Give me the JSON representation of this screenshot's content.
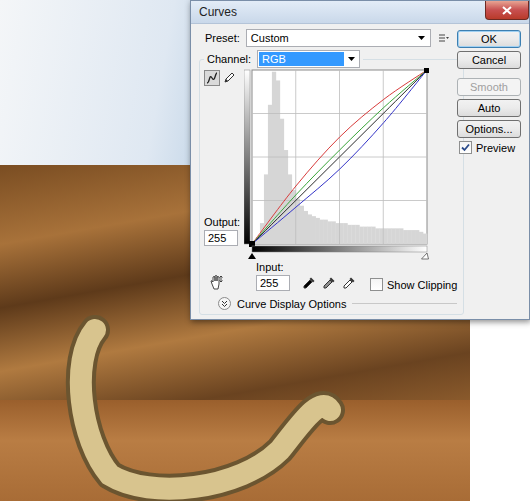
{
  "window": {
    "title": "Curves"
  },
  "preset": {
    "label": "Preset:",
    "value": "Custom"
  },
  "channel": {
    "label": "Channel:",
    "value": "RGB",
    "selected": true
  },
  "tools": [
    {
      "kind": "curve",
      "selected": true
    },
    {
      "kind": "pencil",
      "selected": false
    }
  ],
  "output": {
    "label": "Output:",
    "value": "255"
  },
  "input": {
    "label": "Input:",
    "value": "255"
  },
  "eyedroppers": [
    {
      "kind": "black"
    },
    {
      "kind": "gray"
    },
    {
      "kind": "white"
    }
  ],
  "show_clipping": {
    "label": "Show Clipping",
    "checked": false
  },
  "display_options": {
    "label": "Curve Display Options",
    "expanded": false
  },
  "buttons": [
    {
      "label": "OK",
      "default": true,
      "disabled": false
    },
    {
      "label": "Cancel",
      "default": false,
      "disabled": false
    },
    {
      "label": "Smooth",
      "default": false,
      "disabled": true
    },
    {
      "label": "Auto",
      "default": false,
      "disabled": false
    },
    {
      "label": "Options...",
      "default": false,
      "disabled": false
    }
  ],
  "preview": {
    "label": "Preview",
    "checked": true
  },
  "chart": {
    "inputs": [
      0,
      64,
      128,
      192,
      255
    ],
    "curves": [
      {
        "color": "#d83c3c",
        "values": [
          0,
          85,
          157,
          212,
          255
        ]
      },
      {
        "color": "#3aa53a",
        "values": [
          0,
          72,
          138,
          200,
          255
        ]
      },
      {
        "color": "#2a2a2a",
        "values": [
          0,
          64,
          128,
          192,
          255
        ]
      },
      {
        "color": "#3535c8",
        "values": [
          0,
          54,
          110,
          178,
          255
        ]
      }
    ],
    "histogram": [
      2,
      4,
      12,
      40,
      80,
      99,
      94,
      72,
      54,
      40,
      31,
      26,
      22,
      19,
      17,
      16,
      15,
      14,
      14,
      13,
      13,
      12,
      12,
      12,
      11,
      11,
      11,
      10,
      10,
      10,
      10,
      9,
      9,
      9,
      9,
      9,
      9,
      9,
      8,
      8,
      8,
      8,
      7,
      6
    ]
  }
}
